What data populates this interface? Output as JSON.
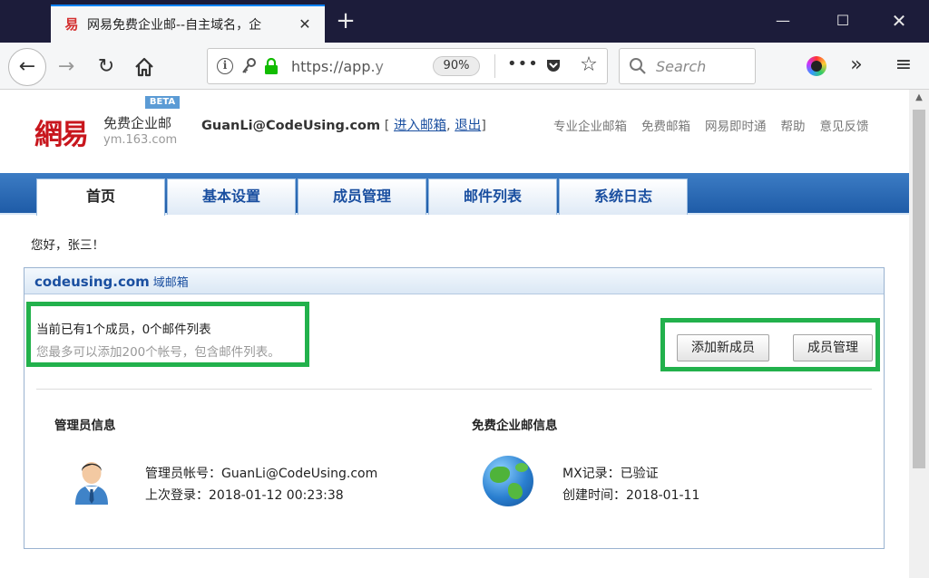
{
  "browser": {
    "tab_title": "网易免费企业邮--自主域名，企",
    "url": "https://app.y",
    "zoom": "90%",
    "search_placeholder": "Search"
  },
  "header": {
    "logo_text": "網易",
    "brand_name": "免费企业邮",
    "brand_domain": "ym.163.com",
    "beta_label": "BETA",
    "account_email": "GuanLi@CodeUsing.com",
    "enter_mailbox": "进入邮箱",
    "logout": "退出",
    "top_links": [
      "专业企业邮箱",
      "免费邮箱",
      "网易即时通",
      "帮助",
      "意见反馈"
    ]
  },
  "nav_tabs": [
    "首页",
    "基本设置",
    "成员管理",
    "邮件列表",
    "系统日志"
  ],
  "greeting": "您好，张三！",
  "panel": {
    "domain": "codeusing.com",
    "domain_suffix": "域邮箱",
    "member_count_text": "当前已有1个成员，0个邮件列表",
    "limit_text": "您最多可以添加200个帐号，包含邮件列表。",
    "add_member_button": "添加新成员",
    "manage_members_button": "成员管理"
  },
  "admin_info": {
    "title": "管理员信息",
    "account": "管理员帐号：GuanLi@CodeUsing.com",
    "last_login": "上次登录：2018-01-12 00:23:38"
  },
  "free_info": {
    "title": "免费企业邮信息",
    "mx_record": "MX记录：已验证",
    "created_time": "创建时间：2018-01-11"
  }
}
